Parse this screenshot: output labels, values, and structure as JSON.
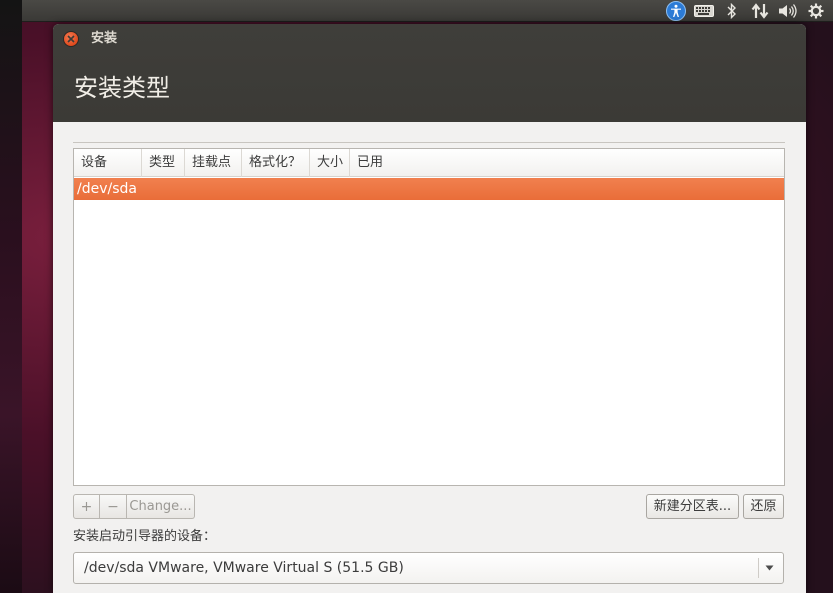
{
  "window": {
    "title": "安装",
    "page_title": "安装类型"
  },
  "partition_table": {
    "columns": [
      "设备",
      "类型",
      "挂载点",
      "格式化？",
      "大小",
      "已用"
    ],
    "rows": [
      {
        "device": "/dev/sda",
        "selected": true
      }
    ]
  },
  "toolbar": {
    "add_label": "+",
    "remove_label": "−",
    "change_label": "Change..."
  },
  "buttons": {
    "new_partition_table": "新建分区表...",
    "revert": "还原"
  },
  "bootloader": {
    "label": "安装启动引导器的设备：",
    "selected_device": "/dev/sda  VMware, VMware Virtual S (51.5 GB)"
  },
  "colors": {
    "accent": "#e96d39",
    "titlebar": "#3c3b37",
    "close_button": "#df4a1d"
  },
  "icons": {
    "tray": [
      "accessibility-icon",
      "keyboard-icon",
      "bluetooth-icon",
      "network-icon",
      "volume-icon",
      "settings-icon"
    ]
  }
}
